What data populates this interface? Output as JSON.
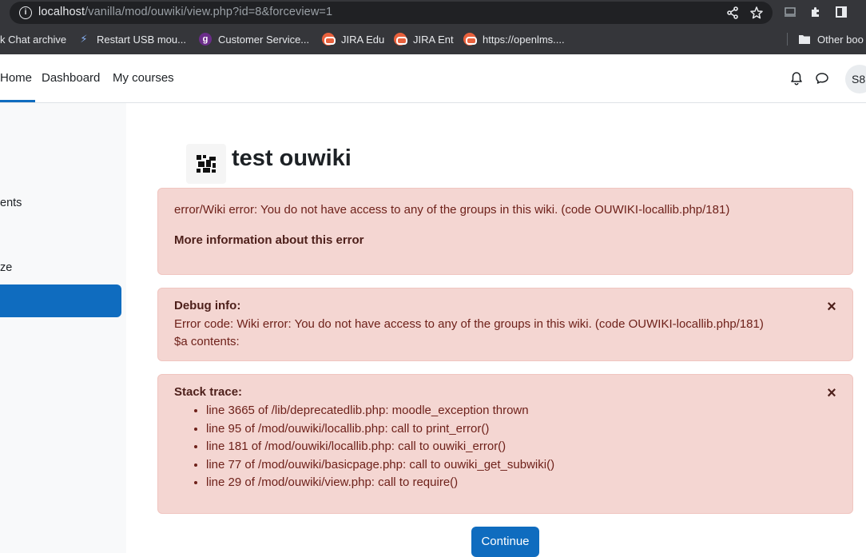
{
  "browser": {
    "url_host": "localhost",
    "url_path": "/vanilla/mod/ouwiki/view.php?id=8&forceview=1",
    "bookmarks": [
      {
        "label": "k Chat archive"
      },
      {
        "label": "Restart USB mou..."
      },
      {
        "label": "Customer Service..."
      },
      {
        "label": "JIRA Edu"
      },
      {
        "label": "JIRA Ent"
      },
      {
        "label": "https://openlms...."
      }
    ],
    "other_bookmarks": "Other boo"
  },
  "navbar": {
    "home": "Home",
    "dashboard": "Dashboard",
    "my_courses": "My courses",
    "avatar_initials": "S8"
  },
  "drawer": {
    "items": [
      {
        "label": "ents"
      },
      {
        "label": "ze"
      }
    ]
  },
  "page": {
    "title": "test ouwiki"
  },
  "error_alert": {
    "message": "error/Wiki error: You do not have access to any of the groups in this wiki. (code OUWIKI-locallib.php/181)",
    "more_info": "More information about this error"
  },
  "debug_alert": {
    "heading": "Debug info:",
    "error_code": "Error code: Wiki error: You do not have access to any of the groups in this wiki. (code OUWIKI-locallib.php/181)",
    "contents": "$a contents:",
    "close": "×"
  },
  "stack_alert": {
    "heading": "Stack trace:",
    "close": "×",
    "lines": [
      "line 3665 of /lib/deprecatedlib.php: moodle_exception thrown",
      "line 95 of /mod/ouwiki/locallib.php: call to print_error()",
      "line 181 of /mod/ouwiki/locallib.php: call to ouwiki_error()",
      "line 77 of /mod/ouwiki/basicpage.php: call to ouwiki_get_subwiki()",
      "line 29 of /mod/ouwiki/view.php: call to require()"
    ]
  },
  "continue_label": "Continue",
  "colors": {
    "primary": "#0f6cbf",
    "alert_bg": "#f4d6d2",
    "alert_text": "#6e211a"
  }
}
